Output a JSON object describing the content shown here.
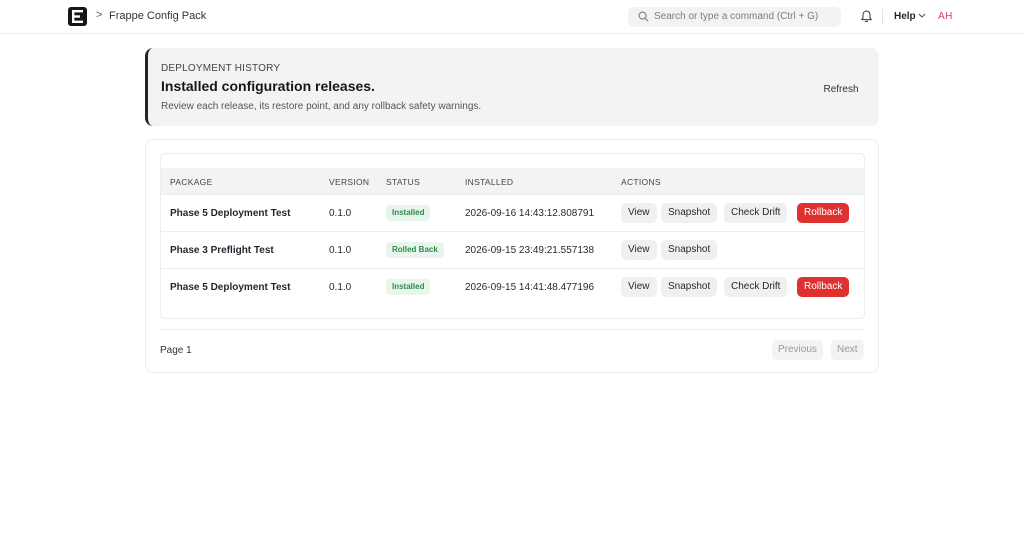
{
  "navbar": {
    "breadcrumb_separator": ">",
    "breadcrumb": "Frappe Config Pack",
    "search_placeholder": "Search or type a command (Ctrl + G)",
    "help_label": "Help",
    "avatar_initials": "AH"
  },
  "hero": {
    "eyebrow": "DEPLOYMENT HISTORY",
    "title": "Installed configuration releases.",
    "subtitle": "Review each release, its restore point, and any rollback safety warnings.",
    "refresh_label": "Refresh"
  },
  "table": {
    "headers": {
      "package": "PACKAGE",
      "version": "VERSION",
      "status": "STATUS",
      "installed": "INSTALLED",
      "actions": "ACTIONS"
    },
    "rows": [
      {
        "package": "Phase 5 Deployment Test",
        "version": "0.1.0",
        "status": "Installed",
        "installed": "2026-09-16 14:43:12.808791",
        "actions": [
          "View",
          "Snapshot",
          "Check Drift",
          "Rollback"
        ]
      },
      {
        "package": "Phase 3 Preflight Test",
        "version": "0.1.0",
        "status": "Rolled Back",
        "installed": "2026-09-15 23:49:21.557138",
        "actions": [
          "View",
          "Snapshot"
        ]
      },
      {
        "package": "Phase 5 Deployment Test",
        "version": "0.1.0",
        "status": "Installed",
        "installed": "2026-09-15 14:41:48.477196",
        "actions": [
          "View",
          "Snapshot",
          "Check Drift",
          "Rollback"
        ]
      }
    ]
  },
  "pagination": {
    "page_label": "Page 1",
    "previous_label": "Previous",
    "next_label": "Next"
  },
  "colors": {
    "danger": "#e03131",
    "success_text": "#2e8c4a",
    "success_bg": "#e7f5ec",
    "avatar": "#d9387a"
  },
  "icons": {
    "logo": "frappe-e-logo",
    "search": "search-icon",
    "notifications": "bell-icon",
    "help_dropdown": "chevron-down-icon"
  }
}
